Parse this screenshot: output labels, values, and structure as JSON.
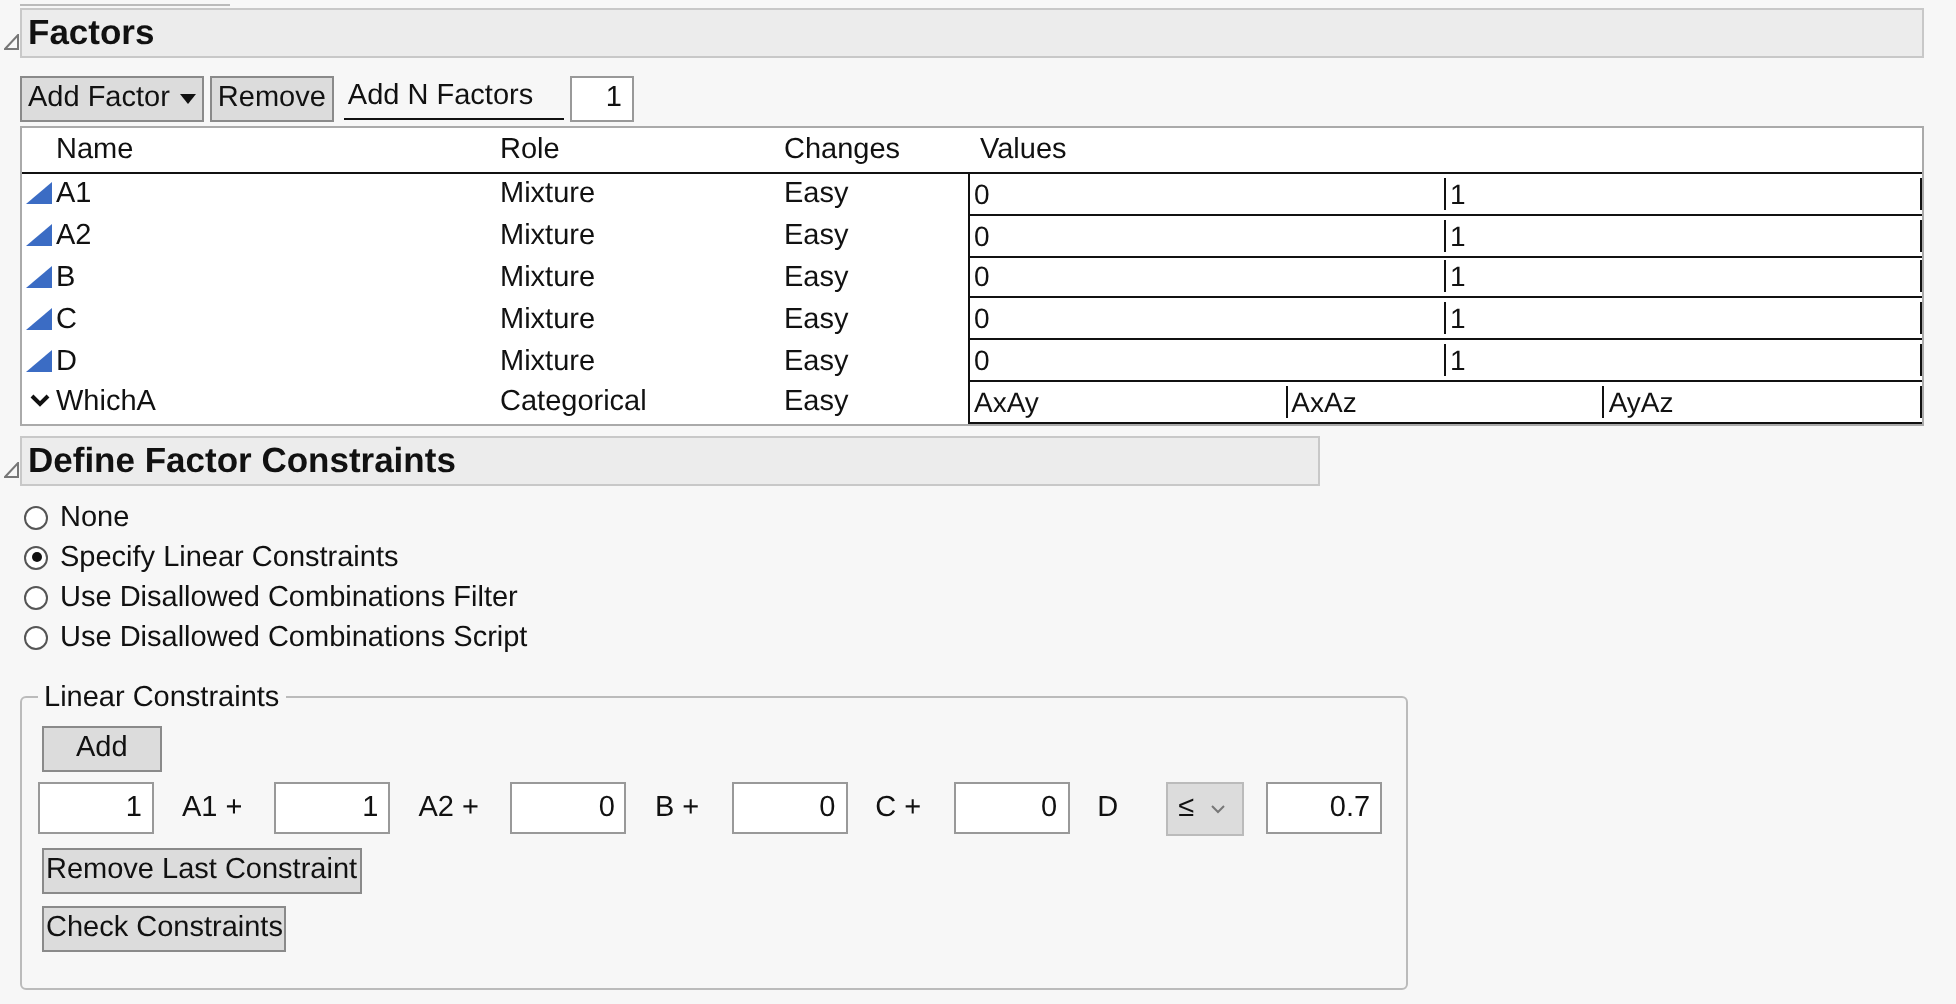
{
  "factors": {
    "title": "Factors",
    "toolbar": {
      "add_factor": "Add Factor",
      "remove": "Remove",
      "add_n_label": "Add N Factors",
      "add_n_value": "1"
    },
    "table": {
      "columns": [
        "Name",
        "Role",
        "Changes",
        "Values"
      ],
      "rows": [
        {
          "name": "A1",
          "kind": "continuous",
          "role": "Mixture",
          "changes": "Easy",
          "values": [
            "0",
            "1"
          ]
        },
        {
          "name": "A2",
          "kind": "continuous",
          "role": "Mixture",
          "changes": "Easy",
          "values": [
            "0",
            "1"
          ]
        },
        {
          "name": "B",
          "kind": "continuous",
          "role": "Mixture",
          "changes": "Easy",
          "values": [
            "0",
            "1"
          ]
        },
        {
          "name": "C",
          "kind": "continuous",
          "role": "Mixture",
          "changes": "Easy",
          "values": [
            "0",
            "1"
          ]
        },
        {
          "name": "D",
          "kind": "continuous",
          "role": "Mixture",
          "changes": "Easy",
          "values": [
            "0",
            "1"
          ]
        },
        {
          "name": "WhichA",
          "kind": "categorical",
          "role": "Categorical",
          "changes": "Easy",
          "values": [
            "AxAy",
            "AxAz",
            "AyAz"
          ]
        }
      ]
    }
  },
  "constraints": {
    "title": "Define Factor Constraints",
    "options": [
      {
        "label": "None",
        "selected": false
      },
      {
        "label": "Specify Linear Constraints",
        "selected": true
      },
      {
        "label": "Use Disallowed Combinations Filter",
        "selected": false
      },
      {
        "label": "Use Disallowed Combinations Script",
        "selected": false
      }
    ],
    "linear": {
      "title": "Linear Constraints",
      "add": "Add",
      "terms": [
        {
          "coefficient": "1",
          "factor": "A1",
          "operator": "+"
        },
        {
          "coefficient": "1",
          "factor": "A2",
          "operator": "+"
        },
        {
          "coefficient": "0",
          "factor": "B",
          "operator": "+"
        },
        {
          "coefficient": "0",
          "factor": "C",
          "operator": "+"
        },
        {
          "coefficient": "0",
          "factor": "D"
        }
      ],
      "relation": "≤",
      "bound": "0.7",
      "remove_last": "Remove Last Constraint",
      "check": "Check Constraints"
    }
  }
}
